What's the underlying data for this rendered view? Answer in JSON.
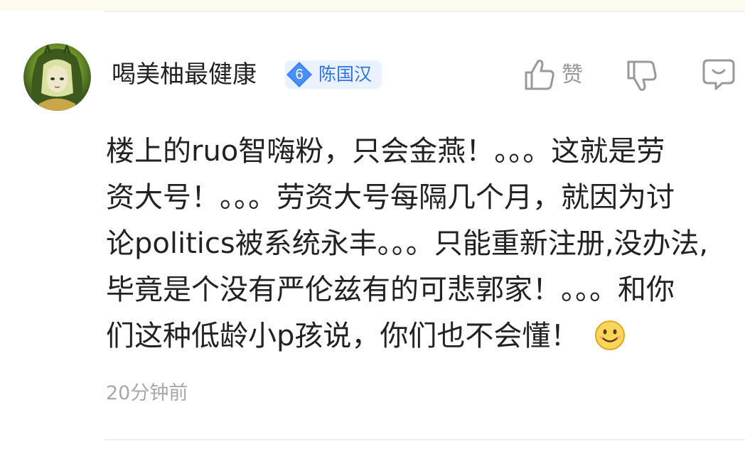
{
  "comment": {
    "username": "喝美柚最健康",
    "badge": {
      "level": "6",
      "name": "陈国汉",
      "color": "#3b82f6"
    },
    "actions": {
      "like_label": "赞",
      "like_icon": "thumbs-up-icon",
      "dislike_icon": "thumbs-down-icon",
      "reply_icon": "comment-bubble-icon"
    },
    "content_lines": [
      "楼上的ruo智嗨粉，只会金燕！。。。这就是劳",
      "资大号！。。。劳资大号每隔几个月，就因为讨",
      "论politics被系统永丰。。。只能重新注册,没办法,",
      "毕竟是个没有严伦兹有的可悲郭家！。。。和你",
      "们这种低龄小p孩说，你们也不会懂！"
    ],
    "emoji": "smile-emoji",
    "timestamp": "20分钟前"
  }
}
